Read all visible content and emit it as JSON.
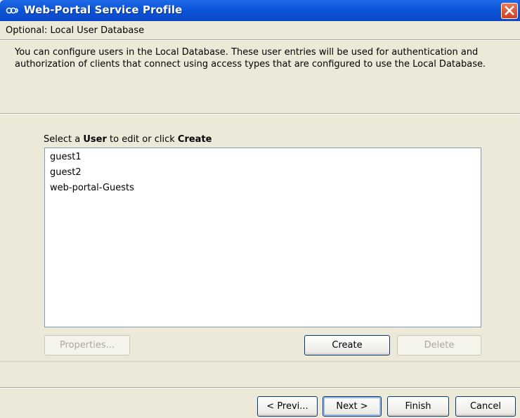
{
  "window": {
    "title": "Web-Portal Service Profile"
  },
  "header": {
    "title": "Optional: Local User Database",
    "description": "You can configure users in the Local Database. These user entries will be used for authentication and authorization of clients that connect using access types that are configured to use the Local Database."
  },
  "users": {
    "label_prefix": "Select a ",
    "label_user": "User",
    "label_middle": " to edit or click ",
    "label_create": "Create",
    "items": [
      "guest1",
      "guest2",
      "web-portal-Guests"
    ]
  },
  "buttons": {
    "properties": "Properties...",
    "create": "Create",
    "delete": "Delete",
    "previous": "< Previ...",
    "next": "Next >",
    "finish": "Finish",
    "cancel": "Cancel"
  },
  "colors": {
    "titlebar": "#0d55d8",
    "dialog_bg": "#ece9d8",
    "close_button": "#cf4020"
  }
}
